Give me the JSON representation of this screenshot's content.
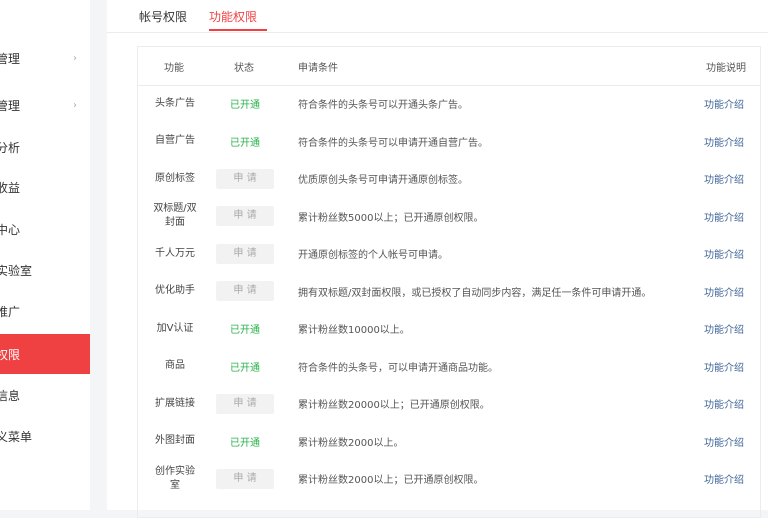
{
  "sidebar": {
    "items": [
      {
        "label": "管理",
        "chevron": "›"
      },
      {
        "label": "管理",
        "chevron": "›"
      },
      {
        "label": "分析"
      },
      {
        "label": "收益"
      },
      {
        "label": "中心"
      },
      {
        "label": "实验室"
      },
      {
        "label": "推广"
      },
      {
        "label": "权限"
      },
      {
        "label": "信息"
      },
      {
        "label": "义菜单"
      }
    ],
    "active_color": "#f04142"
  },
  "tabs": [
    {
      "label": "帐号权限"
    },
    {
      "label": "功能权限"
    }
  ],
  "table": {
    "headers": {
      "name": "功能",
      "status": "状态",
      "condition": "申请条件",
      "desc": "功能说明"
    },
    "rows": [
      {
        "name": "头条广告",
        "status": "已开通",
        "status_type": "on",
        "condition": "符合条件的头条号可以开通头条广告。",
        "link": "功能介绍"
      },
      {
        "name": "自营广告",
        "status": "已开通",
        "status_type": "on",
        "condition": "符合条件的头条号可以申请开通自营广告。",
        "link": "功能介绍"
      },
      {
        "name": "原创标签",
        "status": "申 请",
        "status_type": "apply",
        "condition": "优质原创头条号可申请开通原创标签。",
        "link": "功能介绍"
      },
      {
        "name": "双标题/双封面",
        "status": "申 请",
        "status_type": "apply",
        "condition": "累计粉丝数5000以上；已开通原创权限。",
        "link": "功能介绍"
      },
      {
        "name": "千人万元",
        "status": "申 请",
        "status_type": "apply",
        "condition": "开通原创标签的个人帐号可申请。",
        "link": "功能介绍"
      },
      {
        "name": "优化助手",
        "status": "申 请",
        "status_type": "apply",
        "condition": "拥有双标题/双封面权限，或已授权了自动同步内容，满足任一条件可申请开通。",
        "link": "功能介绍"
      },
      {
        "name": "加V认证",
        "status": "已开通",
        "status_type": "on",
        "condition": "累计粉丝数10000以上。",
        "link": "功能介绍"
      },
      {
        "name": "商品",
        "status": "已开通",
        "status_type": "on",
        "condition": "符合条件的头条号，可以申请开通商品功能。",
        "link": "功能介绍"
      },
      {
        "name": "扩展链接",
        "status": "申 请",
        "status_type": "apply",
        "condition": "累计粉丝数20000以上；已开通原创权限。",
        "link": "功能介绍"
      },
      {
        "name": "外图封面",
        "status": "已开通",
        "status_type": "on",
        "condition": "累计粉丝数2000以上。",
        "link": "功能介绍"
      },
      {
        "name": "创作实验室",
        "status": "申 请",
        "status_type": "apply",
        "condition": "累计粉丝数2000以上；已开通原创权限。",
        "link": "功能介绍"
      }
    ]
  }
}
